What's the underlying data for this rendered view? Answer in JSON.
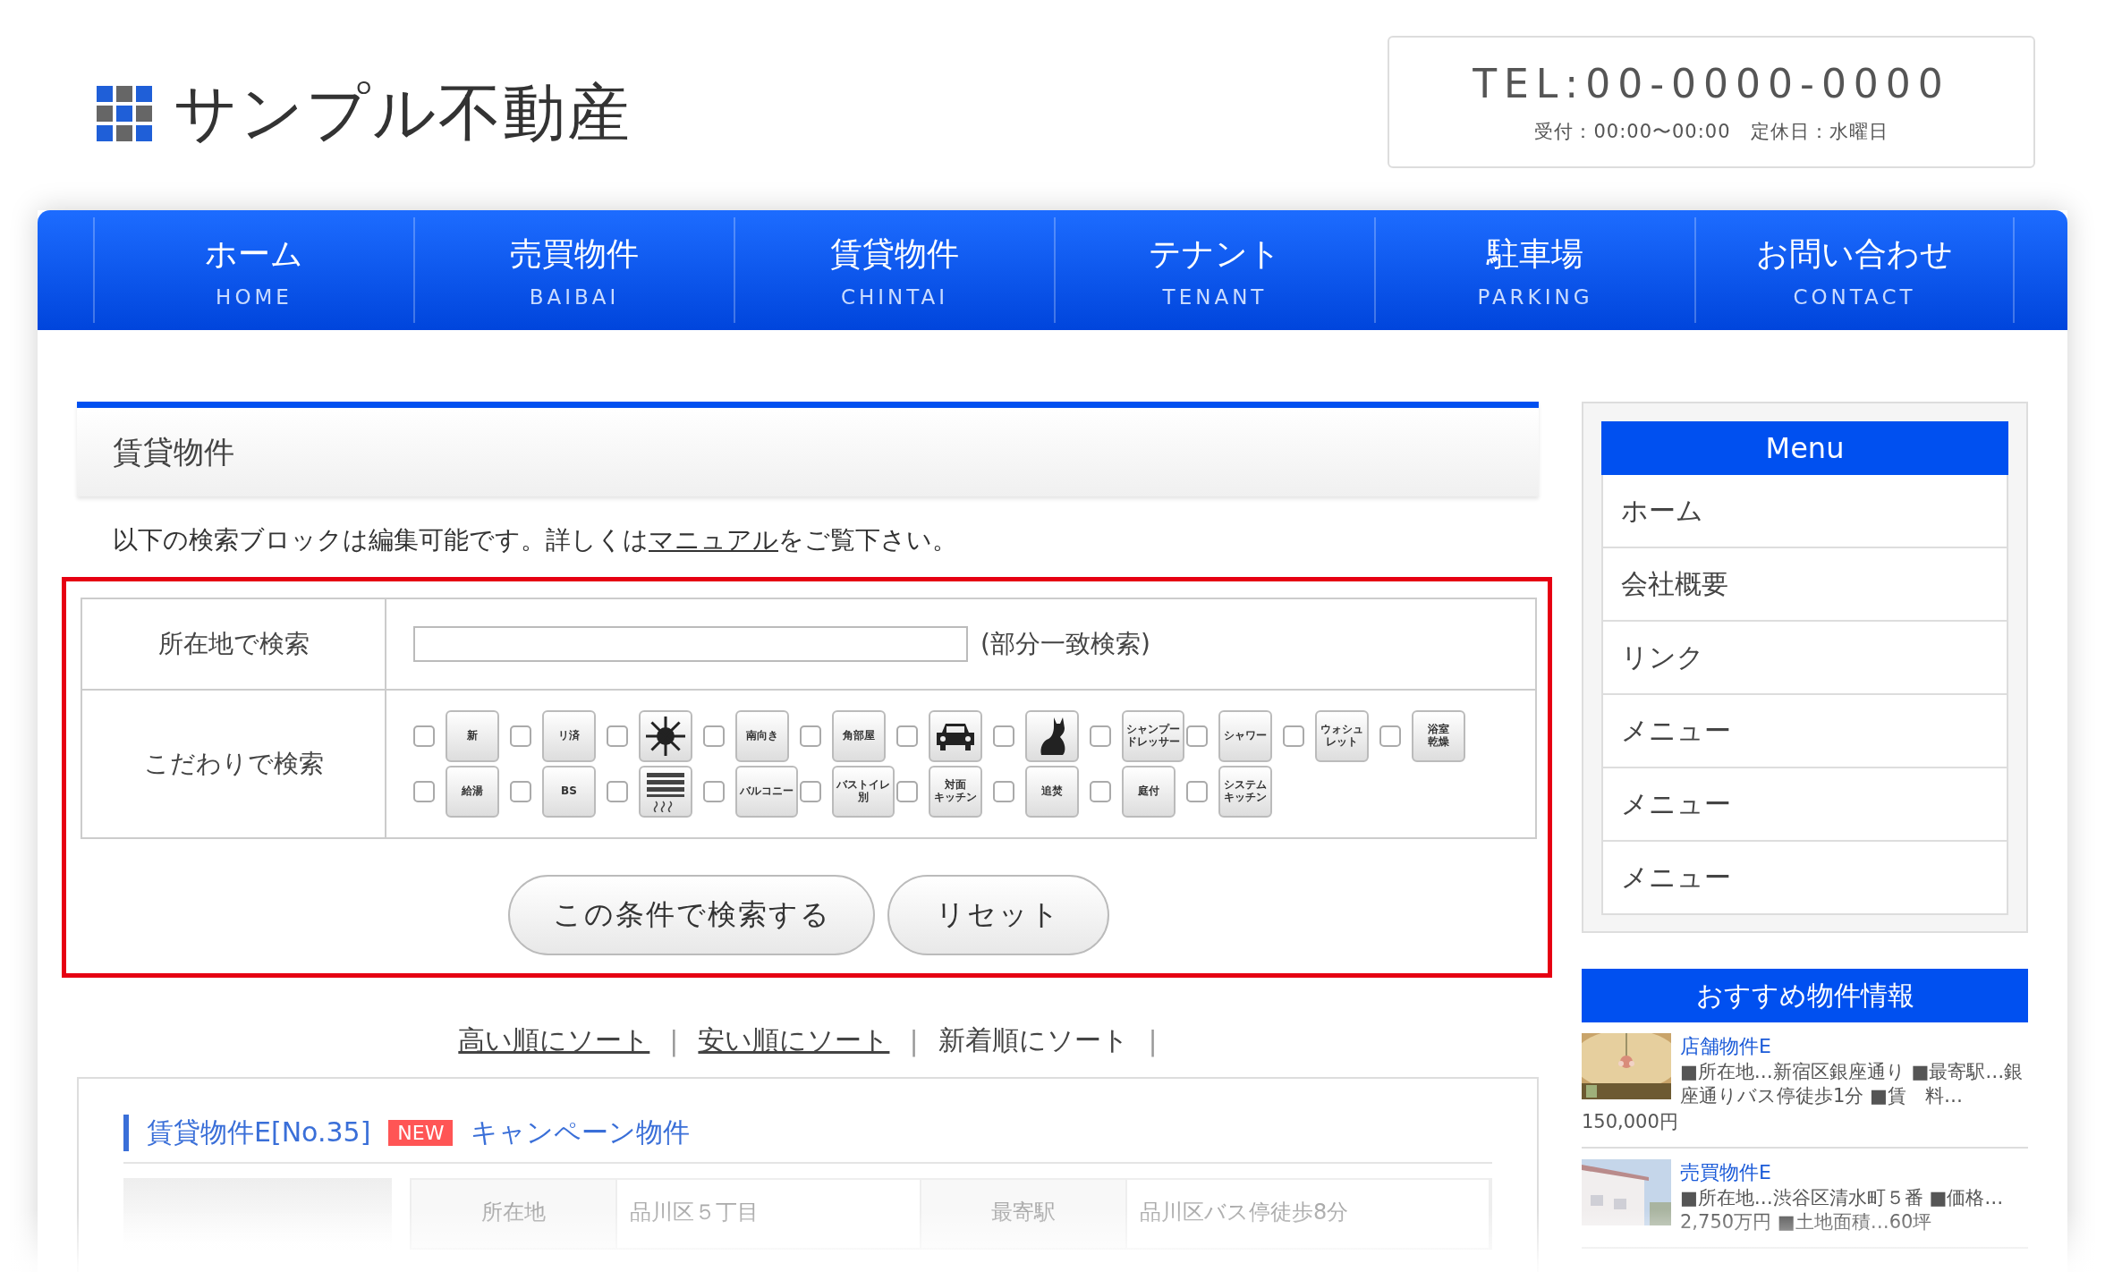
{
  "header": {
    "logo_text": "サンプル不動産",
    "tel": "TEL:00-0000-0000",
    "hours": "受付：00:00〜00:00　定休日：水曜日"
  },
  "nav": [
    {
      "label": "ホーム",
      "sub": "HOME"
    },
    {
      "label": "売買物件",
      "sub": "BAIBAI"
    },
    {
      "label": "賃貸物件",
      "sub": "CHINTAI"
    },
    {
      "label": "テナント",
      "sub": "TENANT"
    },
    {
      "label": "駐車場",
      "sub": "PARKING"
    },
    {
      "label": "お問い合わせ",
      "sub": "CONTACT"
    }
  ],
  "page_title": "賃貸物件",
  "intro": {
    "before": "以下の検索ブロックは編集可能です。詳しくは",
    "link": "マニュアル",
    "after": "をご覧下さい。"
  },
  "search": {
    "location_label": "所在地で検索",
    "location_note": "(部分一致検索)",
    "feature_label": "こだわりで検索",
    "feature_rows": [
      [
        {
          "kind": "text",
          "lines": [
            "新"
          ],
          "checked": false
        },
        {
          "kind": "text",
          "lines": [
            "リ済"
          ],
          "checked": false
        },
        {
          "kind": "sun",
          "checked": false
        },
        {
          "kind": "text",
          "lines": [
            "南向き"
          ],
          "checked": false
        },
        {
          "kind": "text",
          "lines": [
            "角部屋"
          ],
          "checked": false
        },
        {
          "kind": "car",
          "checked": false
        },
        {
          "kind": "cat",
          "checked": false
        },
        {
          "kind": "text",
          "lines": [
            "シャンプー",
            "ドレッサー"
          ],
          "checked": false
        },
        {
          "kind": "text",
          "lines": [
            "シャワー"
          ],
          "checked": false
        },
        {
          "kind": "text",
          "lines": [
            "ウォシュ",
            "レット"
          ],
          "checked": false
        },
        {
          "kind": "text",
          "lines": [
            "浴室",
            "乾燥"
          ],
          "checked": false
        }
      ],
      [
        {
          "kind": "text",
          "lines": [
            "給湯"
          ],
          "checked": false
        },
        {
          "kind": "text",
          "lines": [
            "BS"
          ],
          "checked": false
        },
        {
          "kind": "heater",
          "checked": false
        },
        {
          "kind": "text",
          "lines": [
            "バルコニー"
          ],
          "checked": false
        },
        {
          "kind": "text",
          "lines": [
            "バストイレ",
            "別"
          ],
          "checked": false
        },
        {
          "kind": "text",
          "lines": [
            "対面",
            "キッチン"
          ],
          "checked": false
        },
        {
          "kind": "text",
          "lines": [
            "追焚"
          ],
          "checked": false
        },
        {
          "kind": "text",
          "lines": [
            "庭付"
          ],
          "checked": false
        },
        {
          "kind": "text",
          "lines": [
            "システム",
            "キッチン"
          ],
          "checked": false
        }
      ]
    ],
    "buttons": [
      "この条件で検索する",
      "リセット"
    ]
  },
  "sort_links": [
    {
      "label": "高い順にソート",
      "underlined": true,
      "separator": "|"
    },
    {
      "label": "安い順にソート",
      "underlined": true,
      "separator": "|"
    },
    {
      "label": "新着順にソート",
      "underlined": false,
      "separator": "|"
    }
  ],
  "listing": {
    "title": "賃貸物件E[No.35]",
    "badge": "NEW",
    "tag": "キャンペーン物件",
    "cells": [
      "所在地",
      "品川区５丁目",
      "最寄駅",
      "品川区バス停徒歩8分"
    ]
  },
  "sidebar": {
    "menu_title": "Menu",
    "menu_items": [
      "ホーム",
      "会社概要",
      "リンク",
      "メニュー",
      "メニュー",
      "メニュー"
    ],
    "recommend_title": "おすすめ物件情報",
    "recommend": [
      {
        "title": "店舗物件E",
        "desc": "■所在地…新宿区銀座通り ■最寄駅…銀座通りバス停徒歩1分 ■賃　料…",
        "price": "150,000円",
        "kind": "picture"
      },
      {
        "title": "売買物件E",
        "desc": "■所在地…渋谷区清水町５番 ■価格…2,750万円 ■土地面積…60坪",
        "kind": "picture"
      }
    ]
  }
}
